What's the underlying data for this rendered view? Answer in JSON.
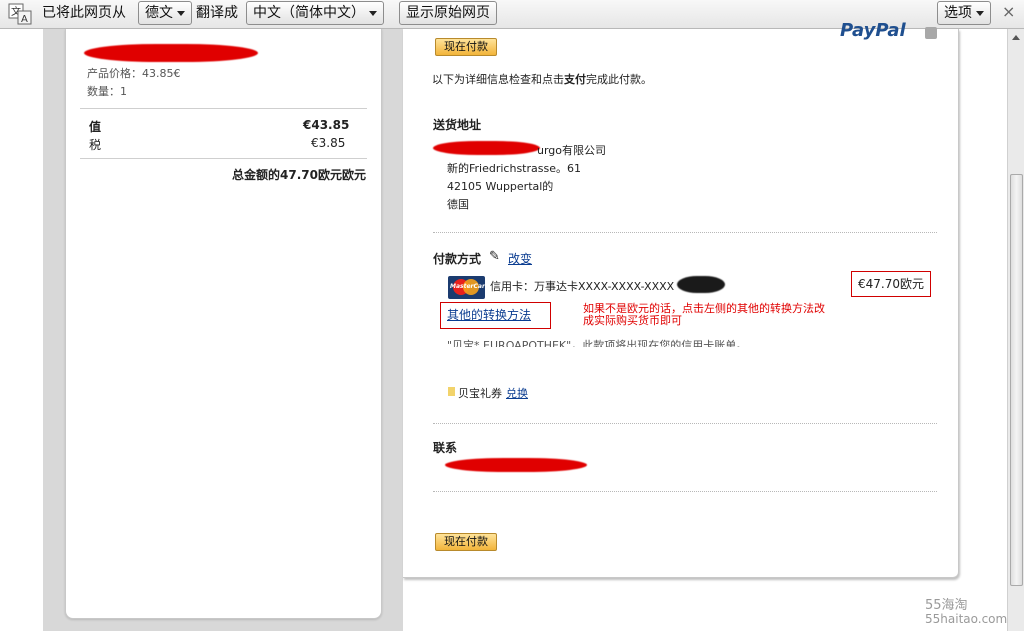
{
  "translate_bar": {
    "prefix": "已将此网页从",
    "source_lang": "德文",
    "middle": "翻译成",
    "target_lang": "中文（简体中文）",
    "show_original": "显示原始网页",
    "options": "选项",
    "close": "×"
  },
  "order_summary": {
    "product_price": "产品价格：43.85€",
    "quantity": "数量：1",
    "value_label": "值",
    "value_amount": "€43.85",
    "tax_label": "税",
    "tax_amount": "€3.85",
    "total": "总金额的47.70欧元欧元"
  },
  "paypal": {
    "logo": "PayPal",
    "pay_now": "现在付款",
    "instructions_pre": "以下为详细信息检查和点击",
    "instructions_bold": "支付",
    "instructions_post": "完成此付款。"
  },
  "shipping": {
    "heading": "送货地址",
    "line1_suffix": "urgo有限公司",
    "line2": "新的Friedrichstrasse。61",
    "line3": "42105 Wuppertal的",
    "line4": "德国"
  },
  "payment": {
    "heading": "付款方式",
    "change": "改变",
    "card_brand": "MasterCard",
    "card_text": "信用卡：万事达卡XXXX-XXXX-XXXX",
    "amount": "€47.70欧元",
    "other_conversion": "其他的转换方法",
    "note_line1": "如果不是欧元的话，点击左侧的其他的转换方法改",
    "note_line2": "成实际购买货币即可",
    "descriptor": "\"贝宝* EUROAPOTHEK\"，此款项将出现在您的信用卡账单。",
    "coupon_label": "贝宝礼券",
    "coupon_link": "兑换"
  },
  "contact": {
    "heading": "联系"
  },
  "watermark": {
    "line1": "55海淘",
    "line2": "55haitao.com"
  }
}
